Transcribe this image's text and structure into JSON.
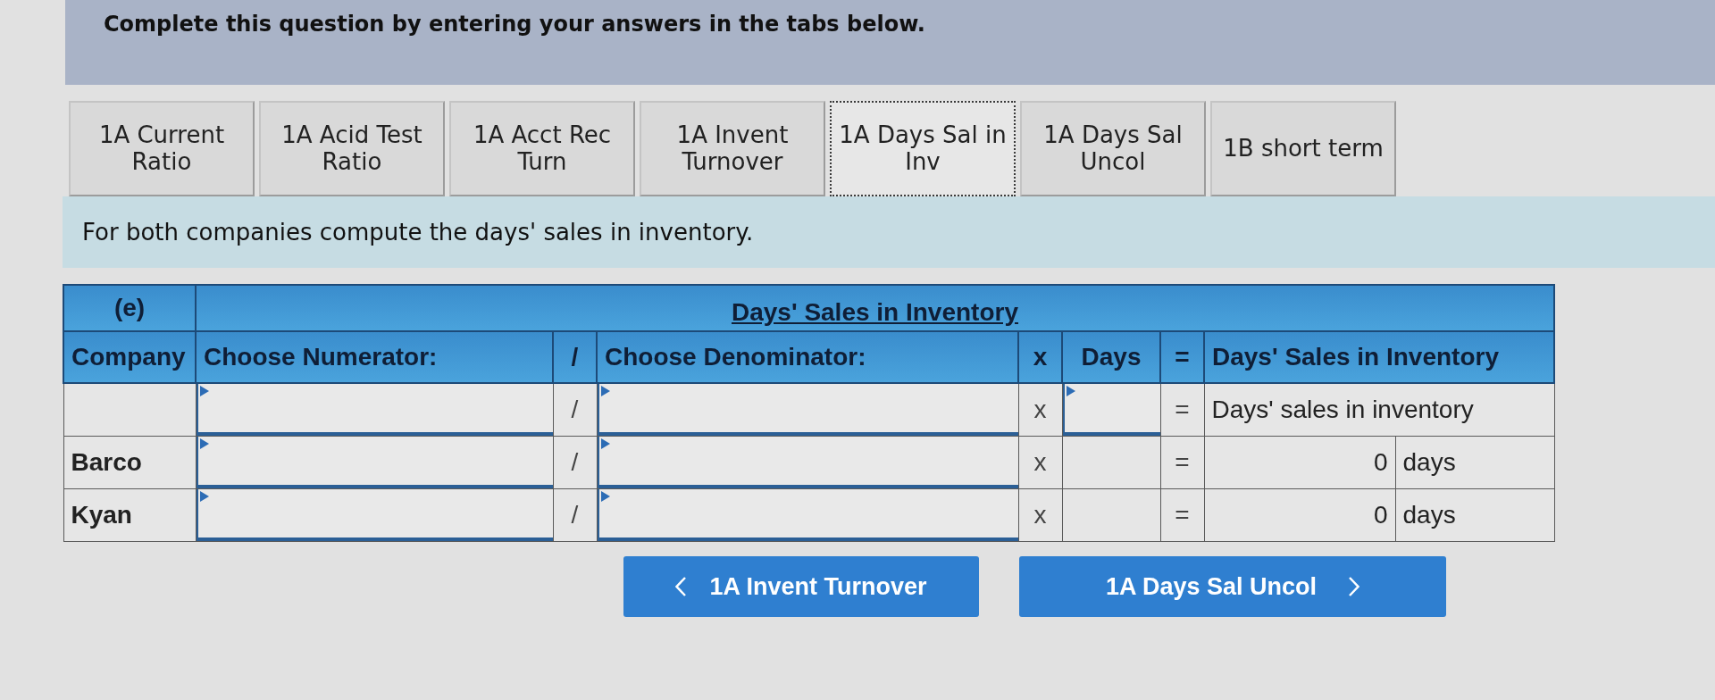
{
  "instructions": "Complete this question by entering your answers in the tabs below.",
  "tabs": [
    {
      "label": "1A Current Ratio",
      "selected": false
    },
    {
      "label": "1A Acid Test Ratio",
      "selected": false
    },
    {
      "label": "1A Acct Rec Turn",
      "selected": false
    },
    {
      "label": "1A Invent Turnover",
      "selected": false
    },
    {
      "label": "1A Days Sal in Inv",
      "selected": true
    },
    {
      "label": "1A Days Sal Uncol",
      "selected": false
    },
    {
      "label": "1B short term",
      "selected": false
    }
  ],
  "prompt": "For both companies compute the days' sales in inventory.",
  "table": {
    "part": "(e)",
    "title": "Days' Sales in Inventory",
    "columns": [
      "Company",
      "Choose Numerator:",
      "/",
      "Choose Denominator:",
      "x",
      "Days",
      "=",
      "Days' Sales in Inventory"
    ],
    "rows": [
      {
        "kind": "formula",
        "divide": "/",
        "multiply": "x",
        "equals": "=",
        "result": "Days' sales in inventory"
      },
      {
        "kind": "company",
        "company": "Barco",
        "divide": "/",
        "multiply": "x",
        "equals": "=",
        "value": "0",
        "unit": "days"
      },
      {
        "kind": "company",
        "company": "Kyan",
        "divide": "/",
        "multiply": "x",
        "equals": "=",
        "value": "0",
        "unit": "days"
      }
    ]
  },
  "navigation": [
    {
      "kind": "previous",
      "label": "1A Invent Turnover"
    },
    {
      "kind": "next",
      "label": "1A Days Sal Uncol"
    }
  ]
}
